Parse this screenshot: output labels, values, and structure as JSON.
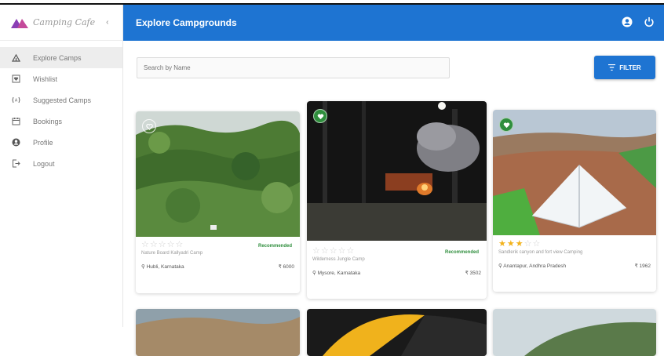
{
  "app": {
    "brand_name": "Camping Cafe"
  },
  "header": {
    "title": "Explore Campgrounds"
  },
  "sidebar": {
    "items": [
      {
        "label": "Explore Camps",
        "icon": "tent-icon",
        "active": true
      },
      {
        "label": "Wishlist",
        "icon": "heart-box-icon"
      },
      {
        "label": "Suggested Camps",
        "icon": "suggest-icon"
      },
      {
        "label": "Bookings",
        "icon": "calendar-icon"
      },
      {
        "label": "Profile",
        "icon": "account-icon"
      },
      {
        "label": "Logout",
        "icon": "logout-icon"
      }
    ]
  },
  "search": {
    "placeholder": "Search by Name"
  },
  "toolbar": {
    "filter_label": "FILTER"
  },
  "cards": [
    {
      "rating": 0,
      "recommended": "Recommended",
      "name": "Nature Board Kallyadri Camp",
      "location": "Hubli, Karnataka",
      "price": "₹ 6000",
      "wishlisted": false
    },
    {
      "rating": 0,
      "recommended": "Recommended",
      "name": "Wilderness Jungle Camp",
      "location": "Mysore, Karnataka",
      "price": "₹ 3502",
      "wishlisted": true
    },
    {
      "rating": 3,
      "recommended": "",
      "name": "Sandlerik canyon and fort view Camping",
      "location": "Anantapur, Andhra Pradesh",
      "price": "₹ 1962",
      "wishlisted": true
    }
  ],
  "colors": {
    "primary": "#1e74d2",
    "recommended": "#2f8e3d",
    "star": "#f2b21b"
  }
}
